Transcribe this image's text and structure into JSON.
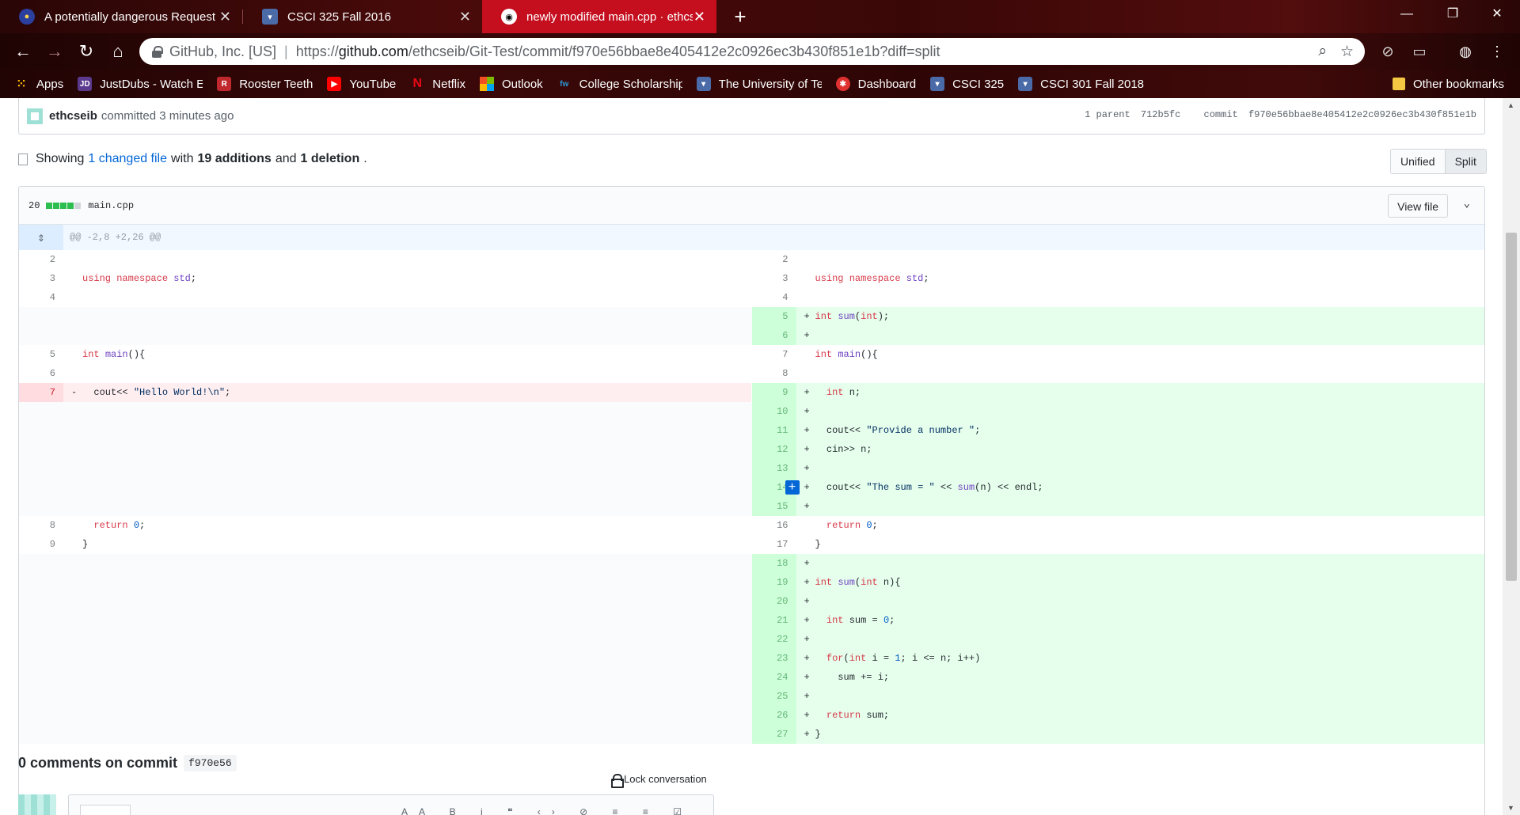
{
  "browser": {
    "tabs": [
      {
        "title": "A potentially dangerous Request",
        "icon": "globe-icon"
      },
      {
        "title": "CSCI 325 Fall 2016",
        "icon": "shield-icon"
      },
      {
        "title": "newly modified main.cpp · ethcseib",
        "icon": "github-icon"
      }
    ],
    "new_tab_label": "+",
    "address": {
      "site_name": "GitHub, Inc. [US]",
      "url_prefix": "https://",
      "url_host": "github.com",
      "url_path": "/ethcseib/Git-Test/commit/f970e56bbae8e405412e2c0926ec3b430f851e1b?diff=split"
    },
    "bookmarks": [
      {
        "label": "Apps",
        "icon": "apps-grid-icon",
        "color": "#f4b400"
      },
      {
        "label": "JustDubs - Watch Eng",
        "icon": "jd-icon",
        "color": "#5b3a8e"
      },
      {
        "label": "Rooster Teeth",
        "icon": "rooster-icon",
        "color": "#c0282d"
      },
      {
        "label": "YouTube",
        "icon": "youtube-icon",
        "color": "#ff0000"
      },
      {
        "label": "Netflix",
        "icon": "netflix-icon",
        "color": "#e50914"
      },
      {
        "label": "Outlook",
        "icon": "microsoft-icon",
        "color": "#0078d4"
      },
      {
        "label": "College Scholarships",
        "icon": "fw-icon",
        "color": "#2a7ab8"
      },
      {
        "label": "The University of Tenn",
        "icon": "shield-icon",
        "color": "#4a6aa8"
      },
      {
        "label": "Dashboard",
        "icon": "dashboard-icon",
        "color": "#e03030"
      },
      {
        "label": "CSCI 325",
        "icon": "shield-icon",
        "color": "#4a6aa8"
      },
      {
        "label": "CSCI 301 Fall 2018",
        "icon": "shield-icon",
        "color": "#4a6aa8"
      }
    ],
    "other_bookmarks": "Other bookmarks"
  },
  "commit": {
    "author": "ethcseib",
    "committed": "committed 3 minutes ago",
    "parent_label": "1 parent",
    "parent_sha": "712b5fc",
    "commit_label": "commit",
    "commit_sha": "f970e56bbae8e405412e2c0926ec3b430f851e1b"
  },
  "summary": {
    "showing": "Showing",
    "changed_files": "1 changed file",
    "with": "with",
    "additions": "19 additions",
    "and": "and",
    "deletions": "1 deletion",
    "period": "."
  },
  "view_toggle": {
    "unified": "Unified",
    "split": "Split",
    "selected": "Split"
  },
  "file": {
    "changes": "20",
    "name": "main.cpp",
    "view_file": "View file",
    "hunk_header": "@@ -2,8 +2,26 @@"
  },
  "diff_rows": [
    {
      "l": {
        "n": "2",
        "code": ""
      },
      "r": {
        "n": "2",
        "code": ""
      }
    },
    {
      "l": {
        "n": "3",
        "code": "using namespace std;"
      },
      "r": {
        "n": "3",
        "code": "using namespace std;"
      }
    },
    {
      "l": {
        "n": "4",
        "code": ""
      },
      "r": {
        "n": "4",
        "code": ""
      }
    },
    {
      "l": null,
      "r": {
        "n": "5",
        "code": "int sum(int);",
        "type": "add"
      }
    },
    {
      "l": null,
      "r": {
        "n": "6",
        "code": "",
        "type": "add"
      }
    },
    {
      "l": {
        "n": "5",
        "code": "int main(){"
      },
      "r": {
        "n": "7",
        "code": "int main(){"
      }
    },
    {
      "l": {
        "n": "6",
        "code": ""
      },
      "r": {
        "n": "8",
        "code": ""
      }
    },
    {
      "l": {
        "n": "7",
        "code": "  cout<< \"Hello World!\\n\";",
        "type": "del"
      },
      "r": {
        "n": "9",
        "code": "  int n;",
        "type": "add"
      }
    },
    {
      "l": null,
      "r": {
        "n": "10",
        "code": "",
        "type": "add"
      }
    },
    {
      "l": null,
      "r": {
        "n": "11",
        "code": "  cout<< \"Provide a number \";",
        "type": "add"
      }
    },
    {
      "l": null,
      "r": {
        "n": "12",
        "code": "  cin>> n;",
        "type": "add"
      }
    },
    {
      "l": null,
      "r": {
        "n": "13",
        "code": "",
        "type": "add"
      }
    },
    {
      "l": null,
      "r": {
        "n": "14",
        "code": "  cout<< \"The sum = \" << sum(n) << endl;",
        "type": "add",
        "hover": true
      }
    },
    {
      "l": null,
      "r": {
        "n": "15",
        "code": "",
        "type": "add"
      }
    },
    {
      "l": {
        "n": "8",
        "code": "  return 0;"
      },
      "r": {
        "n": "16",
        "code": "  return 0;"
      }
    },
    {
      "l": {
        "n": "9",
        "code": "}"
      },
      "r": {
        "n": "17",
        "code": "}"
      }
    },
    {
      "l": null,
      "r": {
        "n": "18",
        "code": "",
        "type": "add"
      }
    },
    {
      "l": null,
      "r": {
        "n": "19",
        "code": "int sum(int n){",
        "type": "add"
      }
    },
    {
      "l": null,
      "r": {
        "n": "20",
        "code": "",
        "type": "add"
      }
    },
    {
      "l": null,
      "r": {
        "n": "21",
        "code": "  int sum = 0;",
        "type": "add"
      }
    },
    {
      "l": null,
      "r": {
        "n": "22",
        "code": "",
        "type": "add"
      }
    },
    {
      "l": null,
      "r": {
        "n": "23",
        "code": "  for(int i = 1; i <= n; i++)",
        "type": "add"
      }
    },
    {
      "l": null,
      "r": {
        "n": "24",
        "code": "    sum += i;",
        "type": "add"
      }
    },
    {
      "l": null,
      "r": {
        "n": "25",
        "code": "",
        "type": "add"
      }
    },
    {
      "l": null,
      "r": {
        "n": "26",
        "code": "  return sum;",
        "type": "add"
      }
    },
    {
      "l": null,
      "r": {
        "n": "27",
        "code": "}",
        "type": "add"
      }
    }
  ],
  "comments": {
    "heading": "0 comments on commit",
    "sha": "f970e56",
    "lock": "Lock conversation"
  },
  "colors": {
    "accent": "#0366d6",
    "addition": "#2cbe4e",
    "deletion": "#cb2431",
    "tab_active": "#c50f1f"
  }
}
